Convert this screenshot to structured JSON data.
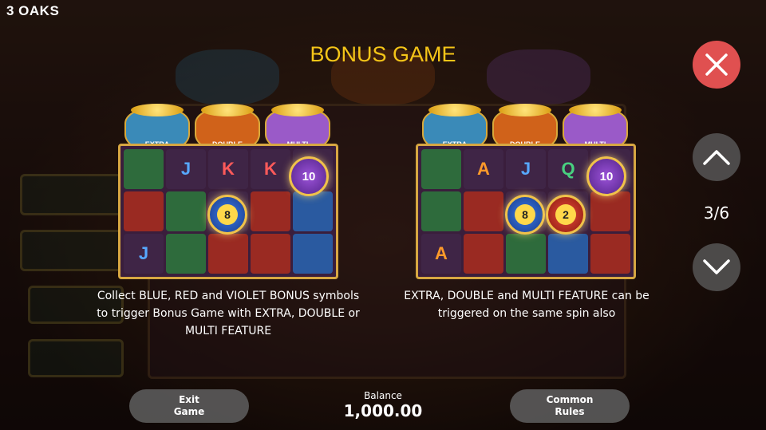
{
  "brand": "3 OAKS",
  "title": "BONUS GAME",
  "panels": [
    {
      "pots": [
        "EXTRA",
        "DOUBLE",
        "MULTI"
      ],
      "grid": [
        [
          "",
          "J",
          "K",
          "K",
          ""
        ],
        [
          "",
          "",
          "",
          "",
          ""
        ],
        [
          "J",
          "",
          "",
          "",
          ""
        ]
      ],
      "coins": {
        "violet": "10",
        "blue": "8"
      },
      "description": "Collect BLUE, RED and VIOLET BONUS symbols to trigger Bonus Game with EXTRA, DOUBLE or MULTI FEATURE"
    },
    {
      "pots": [
        "EXTRA",
        "DOUBLE",
        "MULTI"
      ],
      "grid": [
        [
          "",
          "A",
          "J",
          "Q",
          ""
        ],
        [
          "",
          "",
          "",
          "",
          ""
        ],
        [
          "A",
          "",
          "",
          "",
          ""
        ]
      ],
      "coins": {
        "violet": "10",
        "blue": "8",
        "red": "2"
      },
      "description": "EXTRA, DOUBLE and MULTI FEATURE can be triggered on the same spin also"
    }
  ],
  "controls": {
    "page_indicator": "3/6",
    "exit_label": "Exit\nGame",
    "common_rules_label": "Common\nRules",
    "balance_label": "Balance",
    "balance_value": "1,000.00"
  },
  "colors": {
    "title": "#f5c518",
    "close_button": "#e05050",
    "pot_extra": "#3a8ab8",
    "pot_double": "#d0621a",
    "pot_multi": "#9a5ac8"
  },
  "icons": [
    "close-icon",
    "chevron-up-icon",
    "chevron-down-icon"
  ]
}
